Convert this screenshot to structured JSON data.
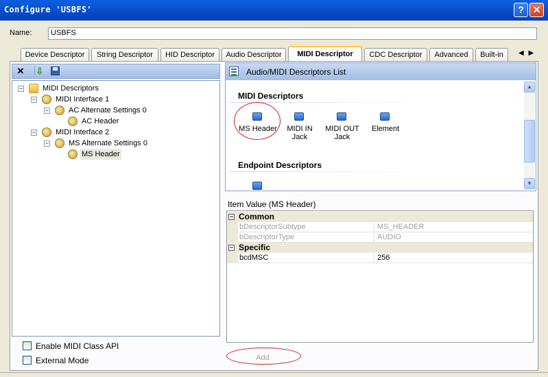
{
  "window": {
    "title": "Configure 'USBFS'"
  },
  "name_field": {
    "label": "Name:",
    "value": "USBFS"
  },
  "tabs": [
    {
      "label": "Device Descriptor"
    },
    {
      "label": "String Descriptor"
    },
    {
      "label": "HID Descriptor"
    },
    {
      "label": "Audio Descriptor"
    },
    {
      "label": "MIDI Descriptor",
      "active": true
    },
    {
      "label": "CDC Descriptor"
    },
    {
      "label": "Advanced"
    },
    {
      "label": "Built-in"
    }
  ],
  "tab_scroll": {
    "left": "◀",
    "right": "▶"
  },
  "tree": {
    "toolbar": {
      "delete": "delete-icon",
      "import": "import-icon",
      "save": "save-icon"
    },
    "nodes": [
      {
        "label": "MIDI Descriptors",
        "icon": "folder-icon",
        "expander": "−"
      },
      {
        "label": "MIDI Interface 1",
        "icon": "speaker-icon",
        "expander": "−"
      },
      {
        "label": "AC Alternate Settings 0",
        "icon": "speaker-icon",
        "expander": "−"
      },
      {
        "label": "AC Header",
        "icon": "speaker-icon"
      },
      {
        "label": "MIDI Interface 2",
        "icon": "speaker-icon",
        "expander": "−"
      },
      {
        "label": "MS Alternate Settings 0",
        "icon": "speaker-icon",
        "expander": "−"
      },
      {
        "label": "MS Header",
        "icon": "speaker-icon",
        "selected": true
      }
    ]
  },
  "options": [
    {
      "label": "Enable MIDI Class API",
      "checked": false
    },
    {
      "label": "External Mode",
      "checked": false
    }
  ],
  "descriptor_list": {
    "header": "Audio/MIDI Descriptors List",
    "sections": [
      {
        "title": "MIDI Descriptors",
        "items": [
          {
            "line1": "MS Header",
            "line2": ""
          },
          {
            "line1": "MIDI IN",
            "line2": "Jack"
          },
          {
            "line1": "MIDI OUT",
            "line2": "Jack"
          },
          {
            "line1": "Element",
            "line2": ""
          }
        ]
      },
      {
        "title": "Endpoint Descriptors",
        "items": []
      }
    ]
  },
  "item_value": {
    "title": "Item Value (MS Header)",
    "categories": [
      {
        "label": "Common",
        "collapse": "−",
        "rows": [
          {
            "name": "bDescriptorSubtype",
            "value": "MS_HEADER",
            "disabled": true
          },
          {
            "name": "bDescriptorType",
            "value": "AUDIO",
            "disabled": true
          }
        ]
      },
      {
        "label": "Specific",
        "collapse": "−",
        "rows": [
          {
            "name": "bcdMSC",
            "value": "256",
            "disabled": false
          }
        ]
      }
    ]
  },
  "add_button": {
    "label": "Add"
  },
  "colors": {
    "titlebar": "#0a58d8",
    "annotation_ellipse": "#d42020",
    "active_tab_accent": "#ffc83c"
  }
}
